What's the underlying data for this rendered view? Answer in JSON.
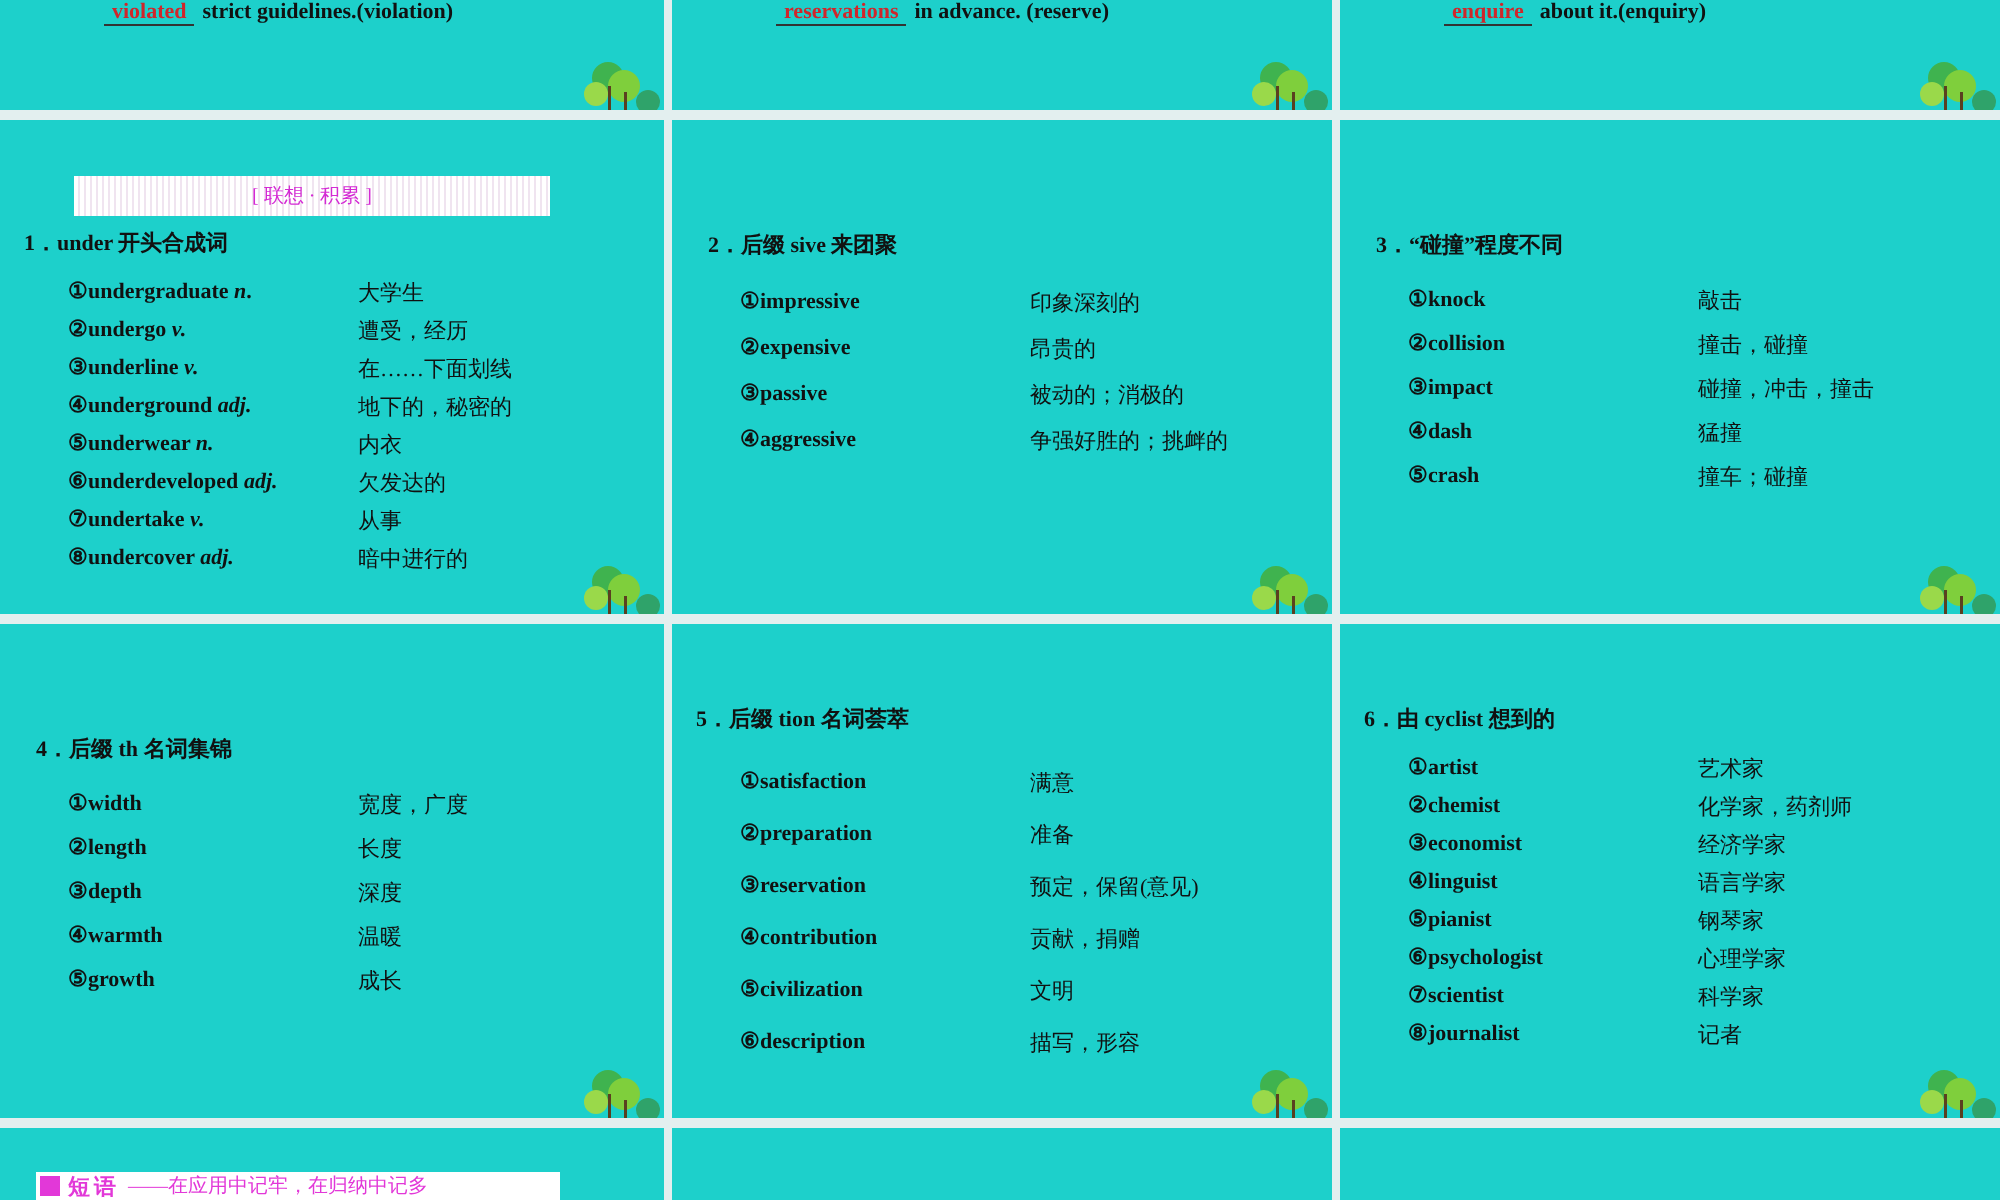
{
  "slides": [
    {
      "kind": "sentence",
      "answer": "violated",
      "text": "strict guidelines.(violation)"
    },
    {
      "kind": "sentence",
      "answer": "reservations",
      "text": "in advance. (reserve)"
    },
    {
      "kind": "sentence",
      "answer": "enquire",
      "text": "about it.(enquiry)"
    },
    {
      "kind": "vocab",
      "banner": "[ 联想 · 积累 ]",
      "heading": "1．under 开头合成词",
      "items": [
        {
          "word": "①undergraduate *n*.",
          "meaning": "大学生"
        },
        {
          "word": "②undergo *v.*",
          "meaning": "遭受，经历"
        },
        {
          "word": "③underline *v.*",
          "meaning": "在……下面划线"
        },
        {
          "word": "④underground *adj.*",
          "meaning": "地下的，秘密的"
        },
        {
          "word": "⑤underwear *n.*",
          "meaning": "内衣"
        },
        {
          "word": "⑥underdeveloped *adj.*",
          "meaning": "欠发达的"
        },
        {
          "word": "⑦undertake *v.*",
          "meaning": "从事"
        },
        {
          "word": "⑧undercover *adj.*",
          "meaning": "暗中进行的"
        }
      ]
    },
    {
      "kind": "vocab",
      "heading": "2．后缀 sive 来团聚",
      "items": [
        {
          "word": "①impressive",
          "meaning": "印象深刻的"
        },
        {
          "word": "②expensive",
          "meaning": "昂贵的"
        },
        {
          "word": "③passive",
          "meaning": "被动的；消极的"
        },
        {
          "word": "④aggressive",
          "meaning": "争强好胜的；挑衅的"
        }
      ]
    },
    {
      "kind": "vocab",
      "heading": "3．“碰撞”程度不同",
      "items": [
        {
          "word": "①knock",
          "meaning": "敲击"
        },
        {
          "word": "②collision",
          "meaning": "撞击，碰撞"
        },
        {
          "word": "③impact",
          "meaning": "碰撞，冲击，撞击"
        },
        {
          "word": "④dash",
          "meaning": "猛撞"
        },
        {
          "word": "⑤crash",
          "meaning": "撞车；碰撞"
        }
      ]
    },
    {
      "kind": "vocab",
      "heading": "4．后缀 th 名词集锦",
      "items": [
        {
          "word": "①width",
          "meaning": "宽度，广度"
        },
        {
          "word": "②length",
          "meaning": "长度"
        },
        {
          "word": "③depth",
          "meaning": "深度"
        },
        {
          "word": "④warmth",
          "meaning": "温暖"
        },
        {
          "word": "⑤growth",
          "meaning": "成长"
        }
      ]
    },
    {
      "kind": "vocab",
      "heading": "5．后缀 tion 名词荟萃",
      "items": [
        {
          "word": "①satisfaction",
          "meaning": "满意"
        },
        {
          "word": "②preparation",
          "meaning": "准备"
        },
        {
          "word": "③reservation",
          "meaning": "预定，保留(意见)"
        },
        {
          "word": "④contribution",
          "meaning": "贡献，捐赠"
        },
        {
          "word": "⑤civilization",
          "meaning": "文明"
        },
        {
          "word": "⑥description",
          "meaning": "描写，形容"
        }
      ]
    },
    {
      "kind": "vocab",
      "heading": "6．由 cyclist 想到的",
      "items": [
        {
          "word": "①artist",
          "meaning": "艺术家"
        },
        {
          "word": "②chemist",
          "meaning": "化学家，药剂师"
        },
        {
          "word": "③economist",
          "meaning": "经济学家"
        },
        {
          "word": "④linguist",
          "meaning": "语言学家"
        },
        {
          "word": "⑤pianist",
          "meaning": "钢琴家"
        },
        {
          "word": "⑥psychologist",
          "meaning": "心理学家"
        },
        {
          "word": "⑦scientist",
          "meaning": "科学家"
        },
        {
          "word": "⑧journalist",
          "meaning": "记者"
        }
      ]
    },
    {
      "kind": "section",
      "badge": "短语",
      "text": "——在应用中记牢，在归纳中记多"
    },
    {
      "kind": "blank"
    },
    {
      "kind": "blank"
    }
  ]
}
